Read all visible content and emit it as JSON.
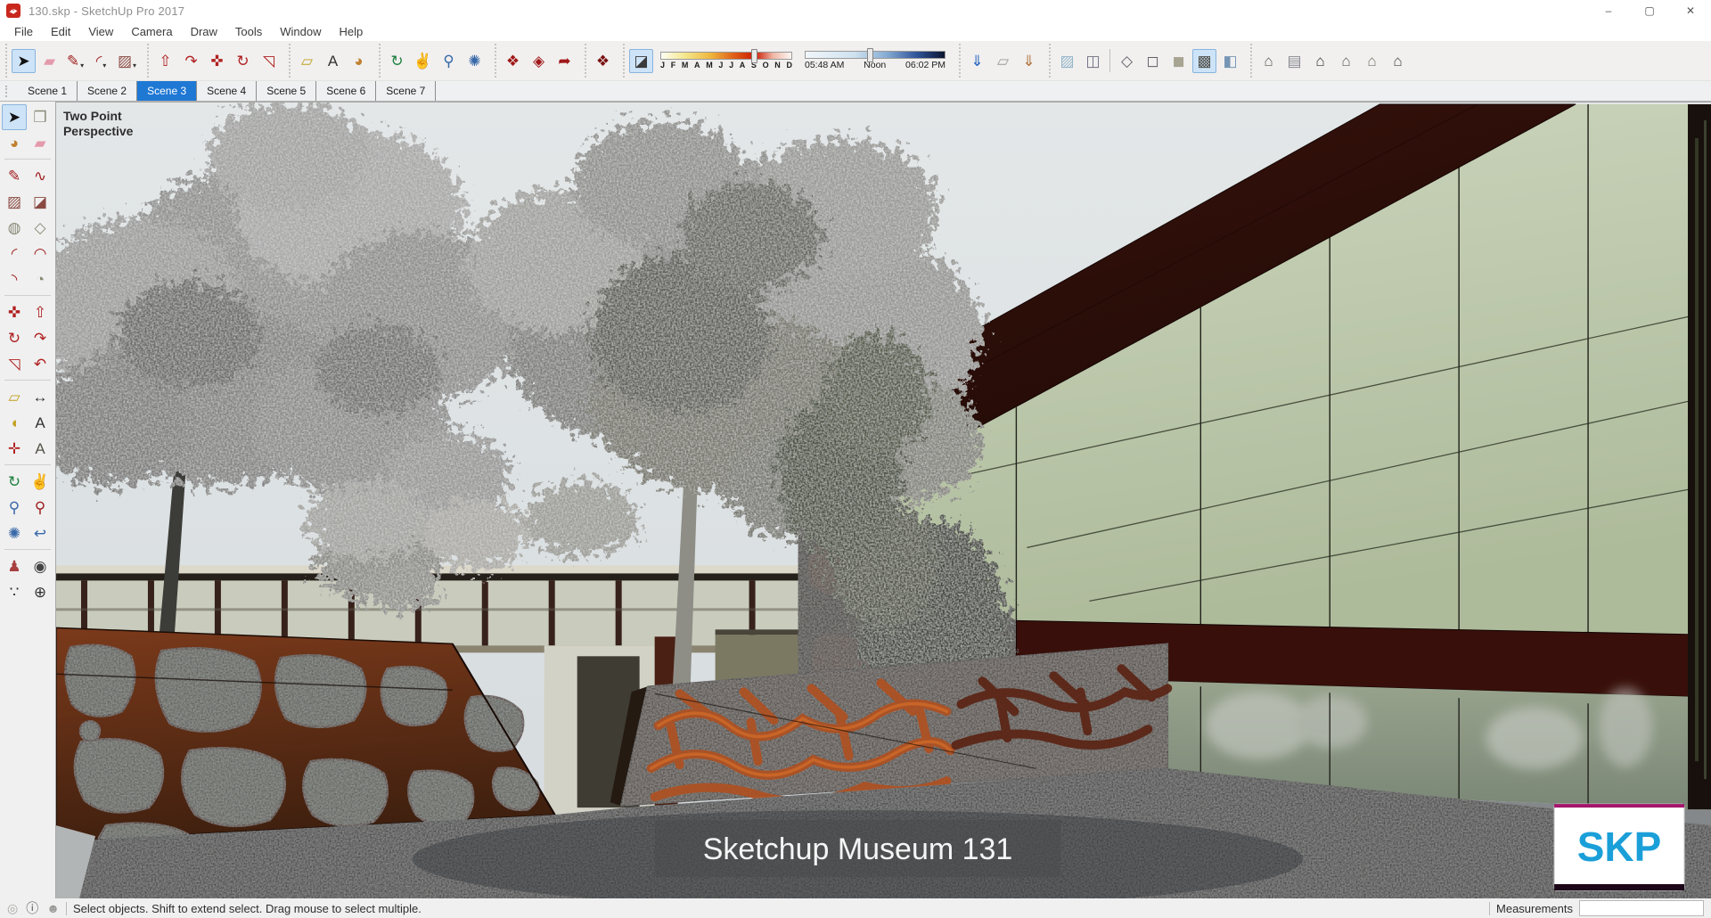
{
  "window": {
    "title": "130.skp - SketchUp Pro 2017",
    "controls": [
      {
        "name": "minimize",
        "glyph": "–"
      },
      {
        "name": "maximize",
        "glyph": "▢"
      },
      {
        "name": "close",
        "glyph": "✕"
      }
    ]
  },
  "menu": {
    "items": [
      "File",
      "Edit",
      "View",
      "Camera",
      "Draw",
      "Tools",
      "Window",
      "Help"
    ]
  },
  "toolbar": {
    "groups": [
      {
        "items": [
          {
            "icon": "select",
            "selected": true
          },
          {
            "icon": "eraser"
          },
          {
            "icon": "line",
            "caret": true
          },
          {
            "icon": "arc",
            "caret": true
          },
          {
            "icon": "rectangle",
            "caret": true
          }
        ]
      },
      {
        "items": [
          {
            "icon": "push-pull"
          },
          {
            "icon": "follow-me"
          },
          {
            "icon": "move"
          },
          {
            "icon": "rotate"
          },
          {
            "icon": "scale"
          }
        ]
      },
      {
        "items": [
          {
            "icon": "tape-measure"
          },
          {
            "icon": "text"
          },
          {
            "icon": "paint-bucket"
          }
        ]
      },
      {
        "items": [
          {
            "icon": "orbit"
          },
          {
            "icon": "pan"
          },
          {
            "icon": "zoom"
          },
          {
            "icon": "zoom-extents"
          }
        ]
      },
      {
        "items": [
          {
            "icon": "extension-warehouse"
          },
          {
            "icon": "warehouse-3d"
          },
          {
            "icon": "send-to-layout"
          }
        ]
      },
      {
        "items": [
          {
            "icon": "extension-manager"
          }
        ]
      },
      {
        "type": "shadows",
        "toggle": {
          "icon": "shadows-toggle",
          "selected": true
        },
        "months": [
          "J",
          "F",
          "M",
          "A",
          "M",
          "J",
          "J",
          "A",
          "S",
          "O",
          "N",
          "D"
        ],
        "month_handle_pct": 71,
        "time_labels": [
          "05:48 AM",
          "Noon",
          "06:02 PM"
        ],
        "time_handle_pct": 46
      },
      {
        "items": [
          {
            "icon": "add-location"
          },
          {
            "icon": "toggle-terrain"
          },
          {
            "icon": "photo-textures"
          }
        ]
      },
      {
        "items": [
          {
            "icon": "xray"
          },
          {
            "icon": "back-edges"
          },
          {
            "sep": true
          },
          {
            "icon": "wireframe"
          },
          {
            "icon": "hidden-line"
          },
          {
            "icon": "shaded"
          },
          {
            "icon": "shaded-textures",
            "selected": true
          },
          {
            "icon": "monochrome"
          }
        ]
      },
      {
        "items": [
          {
            "icon": "view-iso"
          },
          {
            "icon": "view-top"
          },
          {
            "icon": "view-front"
          },
          {
            "icon": "view-right"
          },
          {
            "icon": "view-back"
          },
          {
            "icon": "view-left"
          }
        ]
      }
    ]
  },
  "scene_tabs": {
    "tabs": [
      "Scene 1",
      "Scene 2",
      "Scene 3",
      "Scene 4",
      "Scene 5",
      "Scene 6",
      "Scene 7"
    ],
    "active_index": 2
  },
  "palette": {
    "rows": [
      [
        "select",
        "make-component"
      ],
      [
        "paint-bucket",
        "eraser"
      ],
      [
        "line",
        "freehand"
      ],
      [
        "rectangle",
        "rotated-rectangle"
      ],
      [
        "circle",
        "polygon"
      ],
      [
        "arc",
        "two-point-arc"
      ],
      [
        "three-point-arc",
        "pie"
      ],
      [
        "move",
        "push-pull"
      ],
      [
        "rotate",
        "follow-me"
      ],
      [
        "scale",
        "offset"
      ],
      [
        "tape-measure",
        "dimensions"
      ],
      [
        "protractor",
        "text"
      ],
      [
        "axes",
        "text-3d"
      ],
      [
        "orbit",
        "pan"
      ],
      [
        "zoom",
        "zoom-window"
      ],
      [
        "zoom-extents",
        "previous-view"
      ],
      [
        "position-camera",
        "look-around"
      ],
      [
        "walk",
        "compass"
      ]
    ],
    "selected": "select",
    "separators_after": [
      1,
      6,
      9,
      12,
      15
    ]
  },
  "viewport": {
    "camera_label_line1": "Two Point",
    "camera_label_line2": "Perspective",
    "caption": "Sketchup Museum 131",
    "watermark": "SKP"
  },
  "status_bar": {
    "icons": [
      "geolocation-status",
      "credits-status",
      "sign-in-status"
    ],
    "hint": "Select objects. Shift to extend select. Drag mouse to select multiple.",
    "measurements_label": "Measurements",
    "measurements_value": ""
  },
  "colors": {
    "active_tab": "#1f78d4",
    "selection_bg": "#cde3f7",
    "sky": "#e0e4e6",
    "glass": "#c5cfb5",
    "fascia": "#2e0f0a",
    "corten_rust": "#8a3c1c",
    "corten_bright": "#c9601f",
    "skp_blue": "#1b9fd8",
    "caption_text": "#f5f5f5"
  },
  "icons": {
    "select": {
      "glyph": "➤",
      "color": "#111111"
    },
    "make-component": {
      "glyph": "❒",
      "color": "#8a8a7a"
    },
    "paint-bucket": {
      "glyph": "◕",
      "color": "#c08030"
    },
    "eraser": {
      "glyph": "▰",
      "color": "#e49aac"
    },
    "line": {
      "glyph": "✎",
      "color": "#a02020"
    },
    "freehand": {
      "glyph": "∿",
      "color": "#a02020"
    },
    "rectangle": {
      "glyph": "▨",
      "color": "#8a4a42"
    },
    "rotated-rectangle": {
      "glyph": "◪",
      "color": "#8a4a42"
    },
    "circle": {
      "glyph": "◍",
      "color": "#8a8a78"
    },
    "polygon": {
      "glyph": "◇",
      "color": "#8a8a78"
    },
    "arc": {
      "glyph": "◜",
      "color": "#a02020"
    },
    "two-point-arc": {
      "glyph": "◠",
      "color": "#a02020"
    },
    "three-point-arc": {
      "glyph": "◝",
      "color": "#a02020"
    },
    "pie": {
      "glyph": "◔",
      "color": "#8a8a78"
    },
    "move": {
      "glyph": "✜",
      "color": "#b02020"
    },
    "push-pull": {
      "glyph": "⇧",
      "color": "#b02020"
    },
    "rotate": {
      "glyph": "↻",
      "color": "#b02020"
    },
    "follow-me": {
      "glyph": "↷",
      "color": "#b02020"
    },
    "scale": {
      "glyph": "◹",
      "color": "#b02020"
    },
    "offset": {
      "glyph": "↶",
      "color": "#b02020"
    },
    "tape-measure": {
      "glyph": "▱",
      "color": "#c2a020"
    },
    "dimensions": {
      "glyph": "↔",
      "color": "#333333"
    },
    "protractor": {
      "glyph": "◖",
      "color": "#c2a020"
    },
    "text": {
      "glyph": "A",
      "color": "#333333"
    },
    "axes": {
      "glyph": "✛",
      "color": "#b02020"
    },
    "text-3d": {
      "glyph": "A",
      "color": "#55524a"
    },
    "orbit": {
      "glyph": "↻",
      "color": "#208040"
    },
    "pan": {
      "glyph": "✌",
      "color": "#c8a878"
    },
    "zoom": {
      "glyph": "⚲",
      "color": "#3868a8"
    },
    "zoom-window": {
      "glyph": "⚲",
      "color": "#a02020"
    },
    "zoom-extents": {
      "glyph": "✺",
      "color": "#3868a8"
    },
    "previous-view": {
      "glyph": "↩",
      "color": "#3868a8"
    },
    "position-camera": {
      "glyph": "♟",
      "color": "#a84040"
    },
    "look-around": {
      "glyph": "◉",
      "color": "#444444"
    },
    "walk": {
      "glyph": "∵",
      "color": "#222222"
    },
    "compass": {
      "glyph": "⊕",
      "color": "#333333"
    },
    "extension-warehouse": {
      "glyph": "❖",
      "color": "#a01818"
    },
    "warehouse-3d": {
      "glyph": "◈",
      "color": "#a01818"
    },
    "send-to-layout": {
      "glyph": "➦",
      "color": "#a01818"
    },
    "extension-manager": {
      "glyph": "❖",
      "color": "#7a1010"
    },
    "shadows-toggle": {
      "glyph": "◪",
      "color": "#3a3a3a"
    },
    "add-location": {
      "glyph": "⇓",
      "color": "#2060c0"
    },
    "toggle-terrain": {
      "glyph": "▱",
      "color": "#9a9a98"
    },
    "photo-textures": {
      "glyph": "⇓",
      "color": "#b07038"
    },
    "xray": {
      "glyph": "▨",
      "color": "#93b4c9"
    },
    "back-edges": {
      "glyph": "◫",
      "color": "#707080"
    },
    "wireframe": {
      "glyph": "◇",
      "color": "#606068"
    },
    "hidden-line": {
      "glyph": "◻",
      "color": "#606068"
    },
    "shaded": {
      "glyph": "◼",
      "color": "#a8a492"
    },
    "shaded-textures": {
      "glyph": "▩",
      "color": "#50504a"
    },
    "monochrome": {
      "glyph": "◧",
      "color": "#7695b5"
    },
    "view-iso": {
      "glyph": "⌂",
      "color": "#5a5a50"
    },
    "view-top": {
      "glyph": "▤",
      "color": "#888890"
    },
    "view-front": {
      "glyph": "⌂",
      "color": "#30302c"
    },
    "view-right": {
      "glyph": "⌂",
      "color": "#606058"
    },
    "view-back": {
      "glyph": "⌂",
      "color": "#737368"
    },
    "view-left": {
      "glyph": "⌂",
      "color": "#45453e"
    },
    "geolocation-status": {
      "glyph": "◎",
      "color": "#a8a8a6"
    },
    "credits-status": {
      "glyph": "ⓘ",
      "color": "#4a4a4a"
    },
    "sign-in-status": {
      "glyph": "☻",
      "color": "#9a9a98"
    },
    "caret": {
      "glyph": "▾",
      "color": "#333333"
    }
  }
}
